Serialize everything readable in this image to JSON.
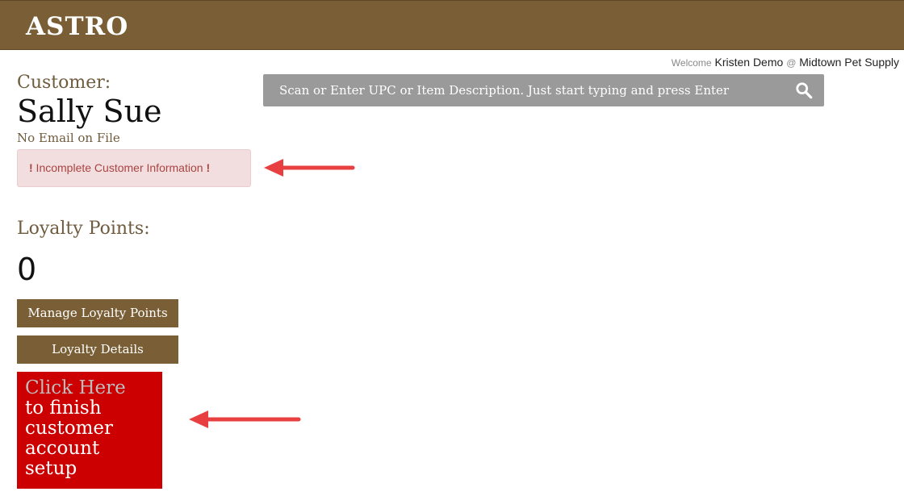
{
  "header": {
    "logo": "ASTRO",
    "brand_color": "#7a5f36"
  },
  "welcome": {
    "prefix": "Welcome",
    "user": "Kristen Demo",
    "at": "@",
    "store": "Midtown Pet Supply"
  },
  "customer": {
    "label": "Customer:",
    "name": "Sally Sue",
    "email_status": "No Email on File",
    "alert": {
      "bang_left": "!",
      "text": " Incomplete Customer Information ",
      "bang_right": "!"
    }
  },
  "loyalty": {
    "label": "Loyalty Points:",
    "value": "0",
    "manage_button": "Manage Loyalty Points",
    "details_button": "Loyalty Details"
  },
  "finish_setup": {
    "highlight": "Click Here",
    "line1": "to finish",
    "line2": "customer",
    "line3": "account",
    "line4": "setup",
    "bg_color": "#cc0000"
  },
  "search": {
    "placeholder": "Scan or Enter UPC or Item Description. Just start typing and press Enter",
    "icon": "search-icon"
  },
  "annotations": {
    "arrow_color": "#e84040"
  }
}
